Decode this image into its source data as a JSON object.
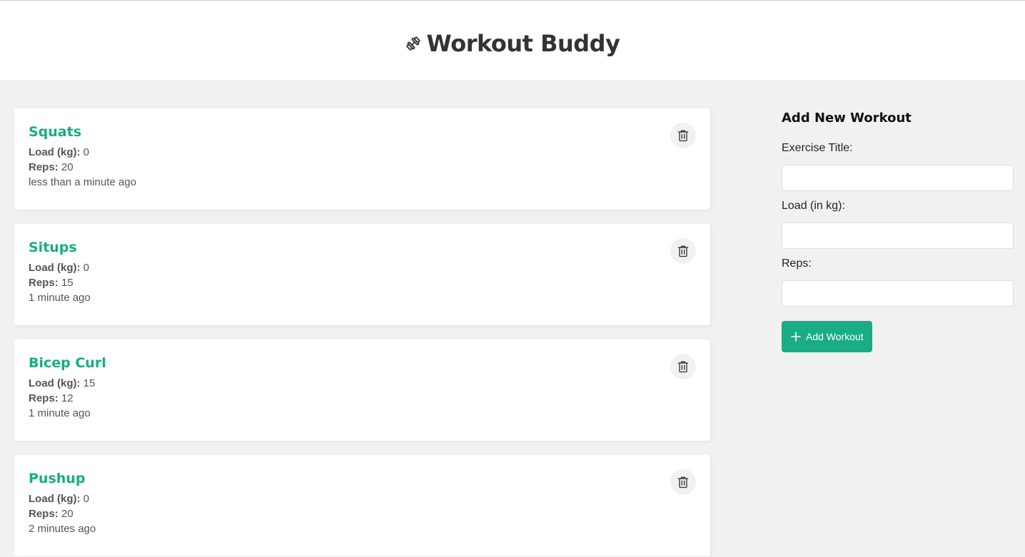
{
  "header": {
    "title": "Workout Buddy",
    "logo_icon": "dumbbell-icon"
  },
  "workouts": [
    {
      "title": "Squats",
      "load_label": "Load (kg):",
      "load": "0",
      "reps_label": "Reps:",
      "reps": "20",
      "time": "less than a minute ago"
    },
    {
      "title": "Situps",
      "load_label": "Load (kg):",
      "load": "0",
      "reps_label": "Reps:",
      "reps": "15",
      "time": "1 minute ago"
    },
    {
      "title": "Bicep Curl",
      "load_label": "Load (kg):",
      "load": "15",
      "reps_label": "Reps:",
      "reps": "12",
      "time": "1 minute ago"
    },
    {
      "title": "Pushup",
      "load_label": "Load (kg):",
      "load": "0",
      "reps_label": "Reps:",
      "reps": "20",
      "time": "2 minutes ago"
    }
  ],
  "form": {
    "heading": "Add New Workout",
    "title_label": "Exercise Title:",
    "title_value": "",
    "load_label": "Load (in kg):",
    "load_value": "",
    "reps_label": "Reps:",
    "reps_value": "",
    "submit_label": "Add Workout"
  },
  "colors": {
    "accent": "#1aac83",
    "background": "#f1f1f1",
    "card": "#ffffff"
  }
}
